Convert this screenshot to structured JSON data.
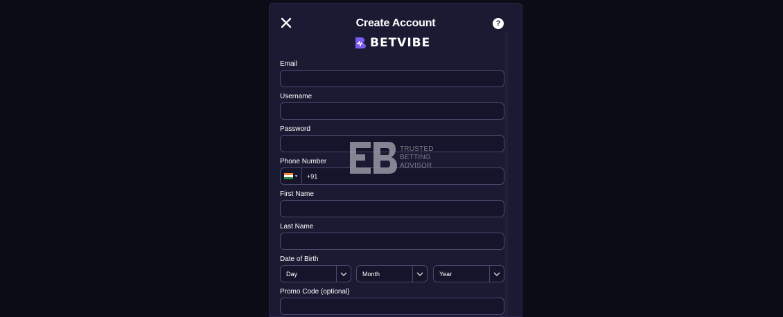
{
  "modal": {
    "title": "Create Account",
    "help_icon": "?",
    "brand": "BETVIBE"
  },
  "fields": {
    "email": {
      "label": "Email",
      "value": "",
      "placeholder": ""
    },
    "username": {
      "label": "Username",
      "value": "",
      "placeholder": ""
    },
    "password": {
      "label": "Password",
      "value": "",
      "placeholder": ""
    },
    "phone": {
      "label": "Phone Number",
      "country": "India",
      "code": "+91"
    },
    "first_name": {
      "label": "First Name",
      "value": "",
      "placeholder": ""
    },
    "last_name": {
      "label": "Last Name",
      "value": "",
      "placeholder": ""
    },
    "dob": {
      "label": "Date of Birth",
      "day": "Day",
      "month": "Month",
      "year": "Year"
    },
    "promo": {
      "label": "Promo Code (optional)",
      "value": "",
      "placeholder": ""
    }
  },
  "watermark": {
    "line1": "TRUSTED",
    "line2": "BETTING",
    "line3": "ADVISOR"
  },
  "icons": {
    "close": "close-icon",
    "help": "help-icon",
    "caret": "chevron-down-icon",
    "flag": "india-flag-icon"
  },
  "colors": {
    "background": "#0c0c16",
    "modal": "#1b1a33",
    "input": "#15142a",
    "border": "#4a496e",
    "brand": "#7b5cf0"
  }
}
